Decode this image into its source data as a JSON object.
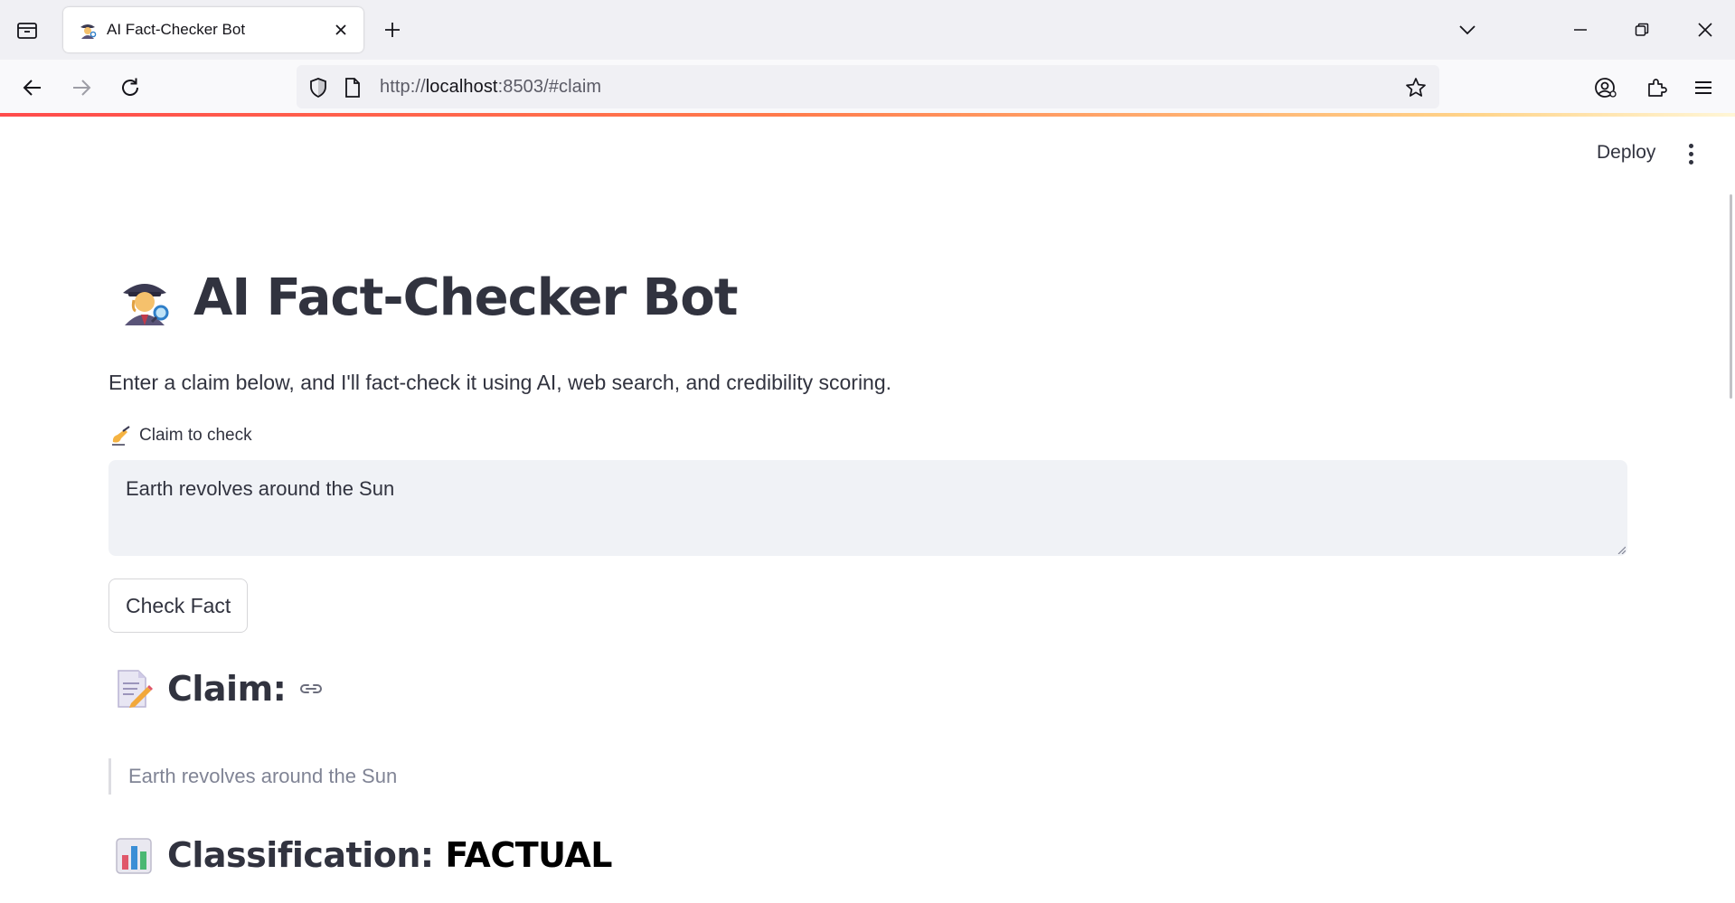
{
  "browser": {
    "tab_title": "AI Fact-Checker Bot",
    "url_scheme": "http://",
    "url_host": "localhost",
    "url_rest": ":8503/#claim"
  },
  "header": {
    "deploy_label": "Deploy"
  },
  "page": {
    "title": "AI Fact-Checker Bot",
    "subtitle": "Enter a claim below, and I'll fact-check it using AI, web search, and credibility scoring.",
    "claim_field_label": "Claim to check",
    "claim_value": "Earth revolves around the Sun",
    "check_button_label": "Check Fact"
  },
  "result": {
    "claim_heading": "Claim:",
    "claim_text": "Earth revolves around the Sun",
    "classification_heading": "Classification: ",
    "classification_value": "FACTUAL"
  },
  "colors": {
    "primary_red": "#ff4b4b",
    "text": "#31333f",
    "input_bg": "#f0f2f6"
  }
}
